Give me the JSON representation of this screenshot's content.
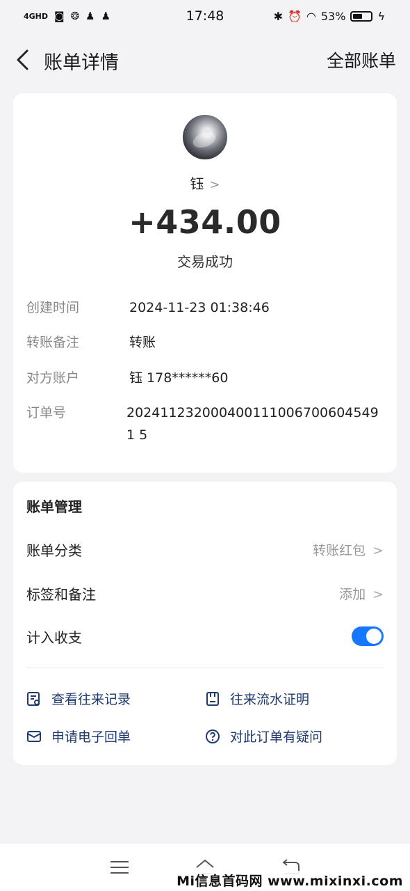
{
  "status_bar": {
    "network": "4GHD",
    "time": "17:48",
    "battery_percent": "53%",
    "battery_level": 0.53
  },
  "nav": {
    "title": "账单详情",
    "right_link": "全部账单"
  },
  "payee": {
    "name": "钰",
    "amount": "+434.00",
    "status": "交易成功"
  },
  "details": [
    {
      "label": "创建时间",
      "value": "2024-11-23 01:38:46"
    },
    {
      "label": "转账备注",
      "value": "转账"
    },
    {
      "label": "对方账户",
      "value": "钰 178******60"
    },
    {
      "label": "订单号",
      "value": "2024112320004001110067006045491 5"
    }
  ],
  "management": {
    "title": "账单管理",
    "category_label": "账单分类",
    "category_value": "转账红包",
    "tags_label": "标签和备注",
    "tags_value": "添加",
    "income_label": "计入收支",
    "income_enabled": true
  },
  "actions": {
    "history": "查看往来记录",
    "proof": "往来流水证明",
    "receipt": "申请电子回单",
    "question": "对此订单有疑问"
  },
  "colors": {
    "accent": "#1677ff",
    "action_text": "#1e3a6e",
    "background": "#f3f3f5"
  },
  "watermark": "Mi信息首码网 www.mixinxi.com"
}
